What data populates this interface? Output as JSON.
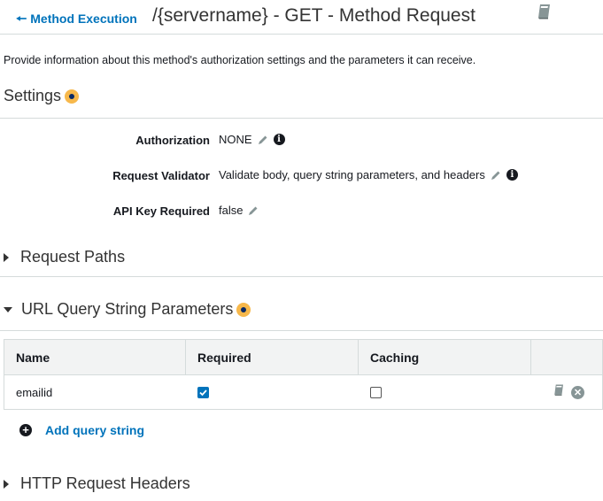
{
  "header": {
    "back_label": "Method Execution",
    "title": "/{servername} - GET - Method Request"
  },
  "description": "Provide information about this method's authorization settings and the parameters it can receive.",
  "settings": {
    "title": "Settings",
    "rows": [
      {
        "label": "Authorization",
        "value": "NONE"
      },
      {
        "label": "Request Validator",
        "value": "Validate body, query string parameters, and headers"
      },
      {
        "label": "API Key Required",
        "value": "false"
      }
    ]
  },
  "sections": {
    "request_paths": "Request Paths",
    "query_params": "URL Query String Parameters",
    "http_headers": "HTTP Request Headers"
  },
  "query_table": {
    "columns": [
      "Name",
      "Required",
      "Caching"
    ],
    "rows": [
      {
        "name": "emailid",
        "required": true,
        "caching": false
      }
    ],
    "add_label": "Add query string"
  },
  "icons": {
    "back": "arrow-left-icon",
    "book": "book-icon",
    "info": "info-circle-icon",
    "edit": "pencil-icon",
    "help": "help-dot-icon",
    "delete": "x-circle-icon",
    "add": "plus-circle-icon"
  },
  "colors": {
    "link": "#0073bb",
    "table_header_bg": "#f2f3f3",
    "help_dot": "#f7b84b"
  }
}
